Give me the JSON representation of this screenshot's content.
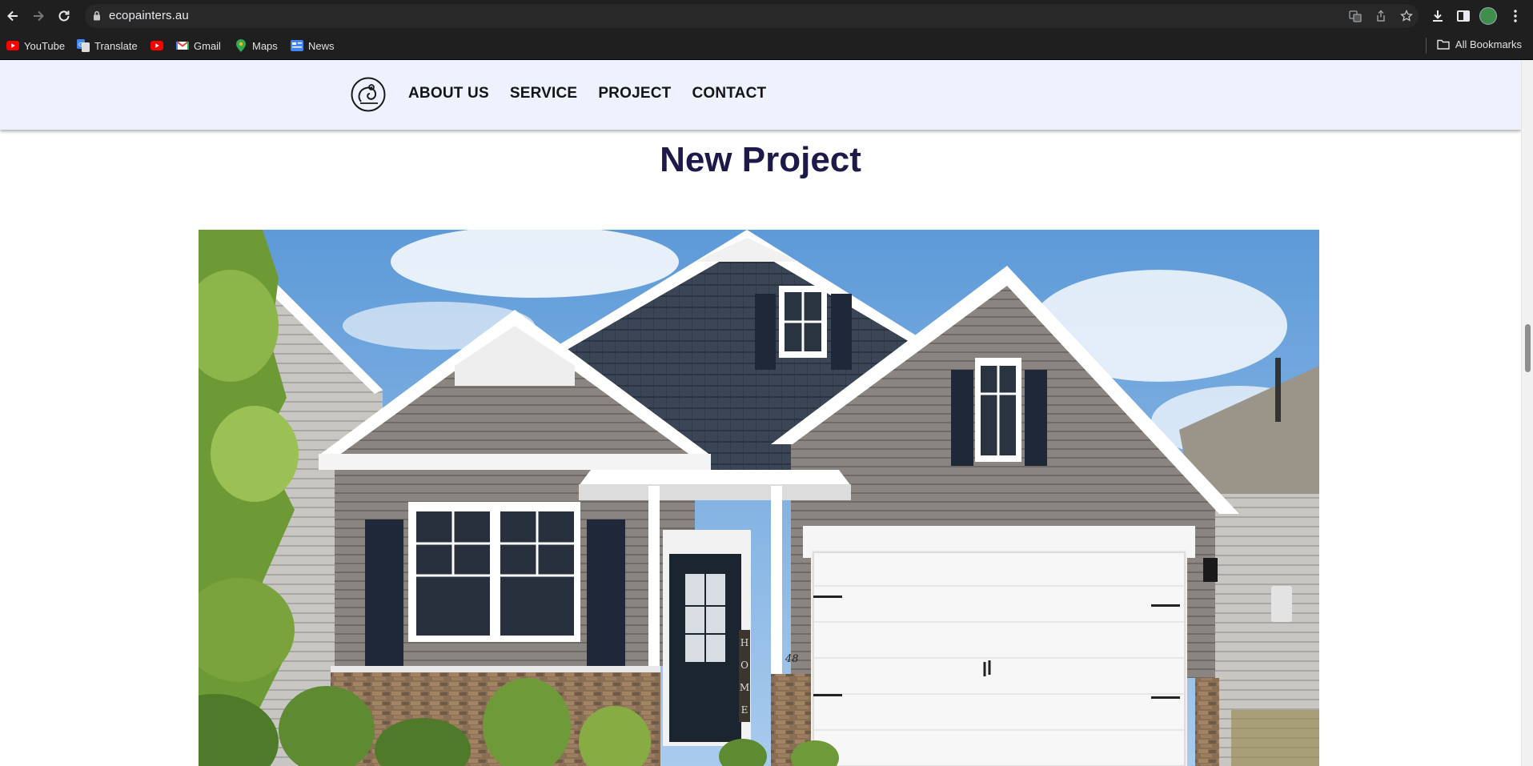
{
  "browser": {
    "url": "ecopainters.au",
    "bookmarks": [
      {
        "label": "YouTube",
        "icon": "youtube-icon"
      },
      {
        "label": "Translate",
        "icon": "translate-icon"
      },
      {
        "label": "",
        "icon": "youtube-icon"
      },
      {
        "label": "Gmail",
        "icon": "gmail-icon"
      },
      {
        "label": "Maps",
        "icon": "maps-icon"
      },
      {
        "label": "News",
        "icon": "news-icon"
      }
    ],
    "all_bookmarks": "All Bookmarks"
  },
  "site": {
    "nav": [
      "ABOUT US",
      "SERVICE",
      "PROJECT",
      "CONTACT"
    ],
    "heading": "New Project",
    "hero_house_number": "48",
    "hero_door_sign": "HOME"
  },
  "colors": {
    "header_bg": "#eef1fe",
    "heading": "#1d1a4a",
    "chrome": "#1f1f1f"
  }
}
